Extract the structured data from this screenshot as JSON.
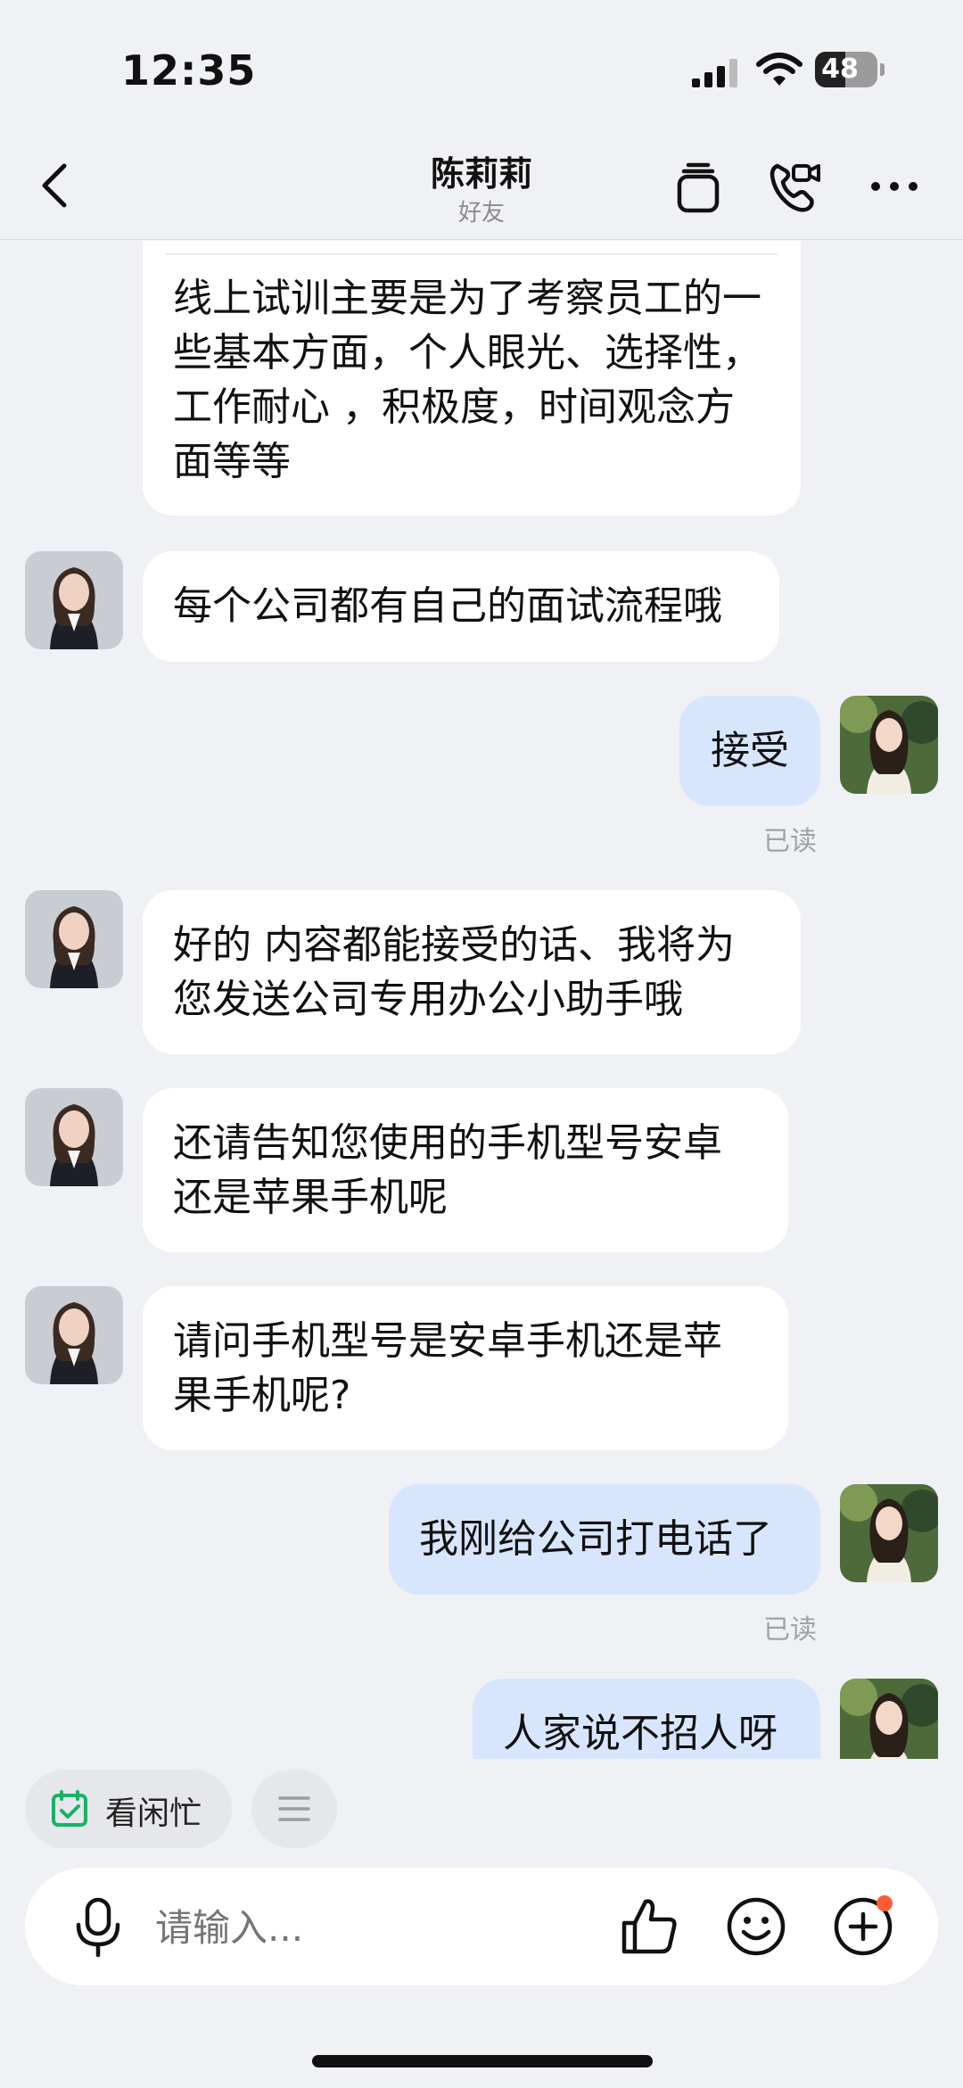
{
  "status": {
    "time": "12:35",
    "battery": "48",
    "battery_level": 0.48
  },
  "header": {
    "title": "陈莉莉",
    "subtitle": "好友"
  },
  "messages": [
    {
      "side": "in",
      "text": "线上试训主要是为了考察员工的一些基本方面，个人眼光、选择性，工作耐心 ，积极度，时间观念方面等等"
    },
    {
      "side": "in",
      "text": "每个公司都有自己的面试流程哦"
    },
    {
      "side": "out",
      "text": "接受",
      "status": "已读"
    },
    {
      "side": "in",
      "text": "好的 内容都能接受的话、我将为您发送公司专用办公小助手哦"
    },
    {
      "side": "in",
      "text": "还请告知您使用的手机型号安卓还是苹果手机呢"
    },
    {
      "side": "in",
      "text": "请问手机型号是安卓手机还是苹果手机呢?"
    },
    {
      "side": "out",
      "text": "我刚给公司打电话了",
      "status": "已读"
    },
    {
      "side": "out",
      "text": "人家说不招人呀"
    }
  ],
  "quick": {
    "busy_label": "看闲忙"
  },
  "input": {
    "placeholder": "请输入..."
  },
  "icons": {
    "back": "chevron-left-icon",
    "cards": "card-stack-icon",
    "call": "video-call-icon",
    "more": "more-icon",
    "calendar": "calendar-check-icon",
    "menu": "menu-icon",
    "mic": "microphone-icon",
    "like": "thumbs-up-icon",
    "emoji": "emoji-icon",
    "plus": "plus-icon"
  },
  "colors": {
    "background": "#f0f1f4",
    "incoming_bubble": "#ffffff",
    "outgoing_bubble": "#d8e6fd",
    "accent_green": "#17b26a",
    "notice_dot": "#ff5a36"
  }
}
